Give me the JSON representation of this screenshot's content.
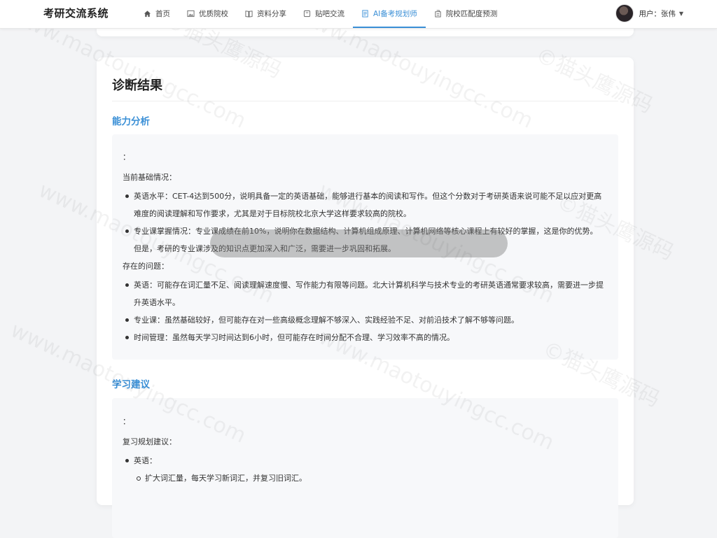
{
  "brand": "考研交流系统",
  "nav": [
    {
      "label": "首页",
      "icon": "home-icon"
    },
    {
      "label": "优质院校",
      "icon": "image-icon"
    },
    {
      "label": "资料分享",
      "icon": "book-icon"
    },
    {
      "label": "贴吧交流",
      "icon": "chat-icon"
    },
    {
      "label": "AI备考规划师",
      "icon": "document-icon",
      "active": true
    },
    {
      "label": "院校匹配度预测",
      "icon": "building-icon"
    }
  ],
  "user": {
    "label": "用户：张伟"
  },
  "result": {
    "title": "诊断结果",
    "ability": {
      "heading": "能力分析",
      "colon": "：",
      "basis_title": "当前基础情况：",
      "basis": [
        "英语水平：CET-4达到500分，说明具备一定的英语基础，能够进行基本的阅读和写作。但这个分数对于考研英语来说可能不足以应对更高难度的阅读理解和写作要求，尤其是对于目标院校北京大学这样要求较高的院校。",
        "专业课掌握情况：专业课成绩在前10%，说明你在数据结构、计算机组成原理、计算机网络等核心课程上有较好的掌握，这是你的优势。但是，考研的专业课涉及的知识点更加深入和广泛，需要进一步巩固和拓展。"
      ],
      "problems_title": "存在的问题：",
      "problems": [
        "英语：可能存在词汇量不足、阅读理解速度慢、写作能力有限等问题。北大计算机科学与技术专业的考研英语通常要求较高，需要进一步提升英语水平。",
        "专业课：虽然基础较好，但可能存在对一些高级概念理解不够深入、实践经验不足、对前沿技术了解不够等问题。",
        "时间管理：虽然每天学习时间达到6小时，但可能存在时间分配不合理、学习效率不高的情况。"
      ]
    },
    "advice": {
      "heading": "学习建议",
      "colon": "：",
      "plan_title": "复习规划建议：",
      "english_label": "英语：",
      "english_items": [
        "扩大词汇量，每天学习新词汇，并复习旧词汇。"
      ]
    }
  },
  "watermark": {
    "text1": "www.maotouyingcc.com",
    "text2": "©猫头鹰源码"
  }
}
